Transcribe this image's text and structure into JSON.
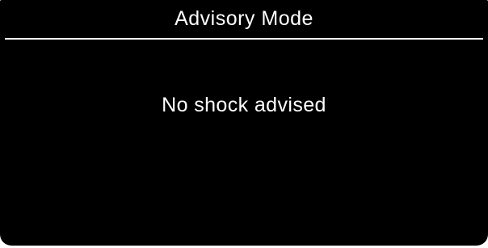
{
  "header": {
    "title": "Advisory Mode"
  },
  "main": {
    "message": "No shock advised"
  },
  "colors": {
    "background": "#000000",
    "text": "#ffffff",
    "rule": "#ffffff"
  }
}
